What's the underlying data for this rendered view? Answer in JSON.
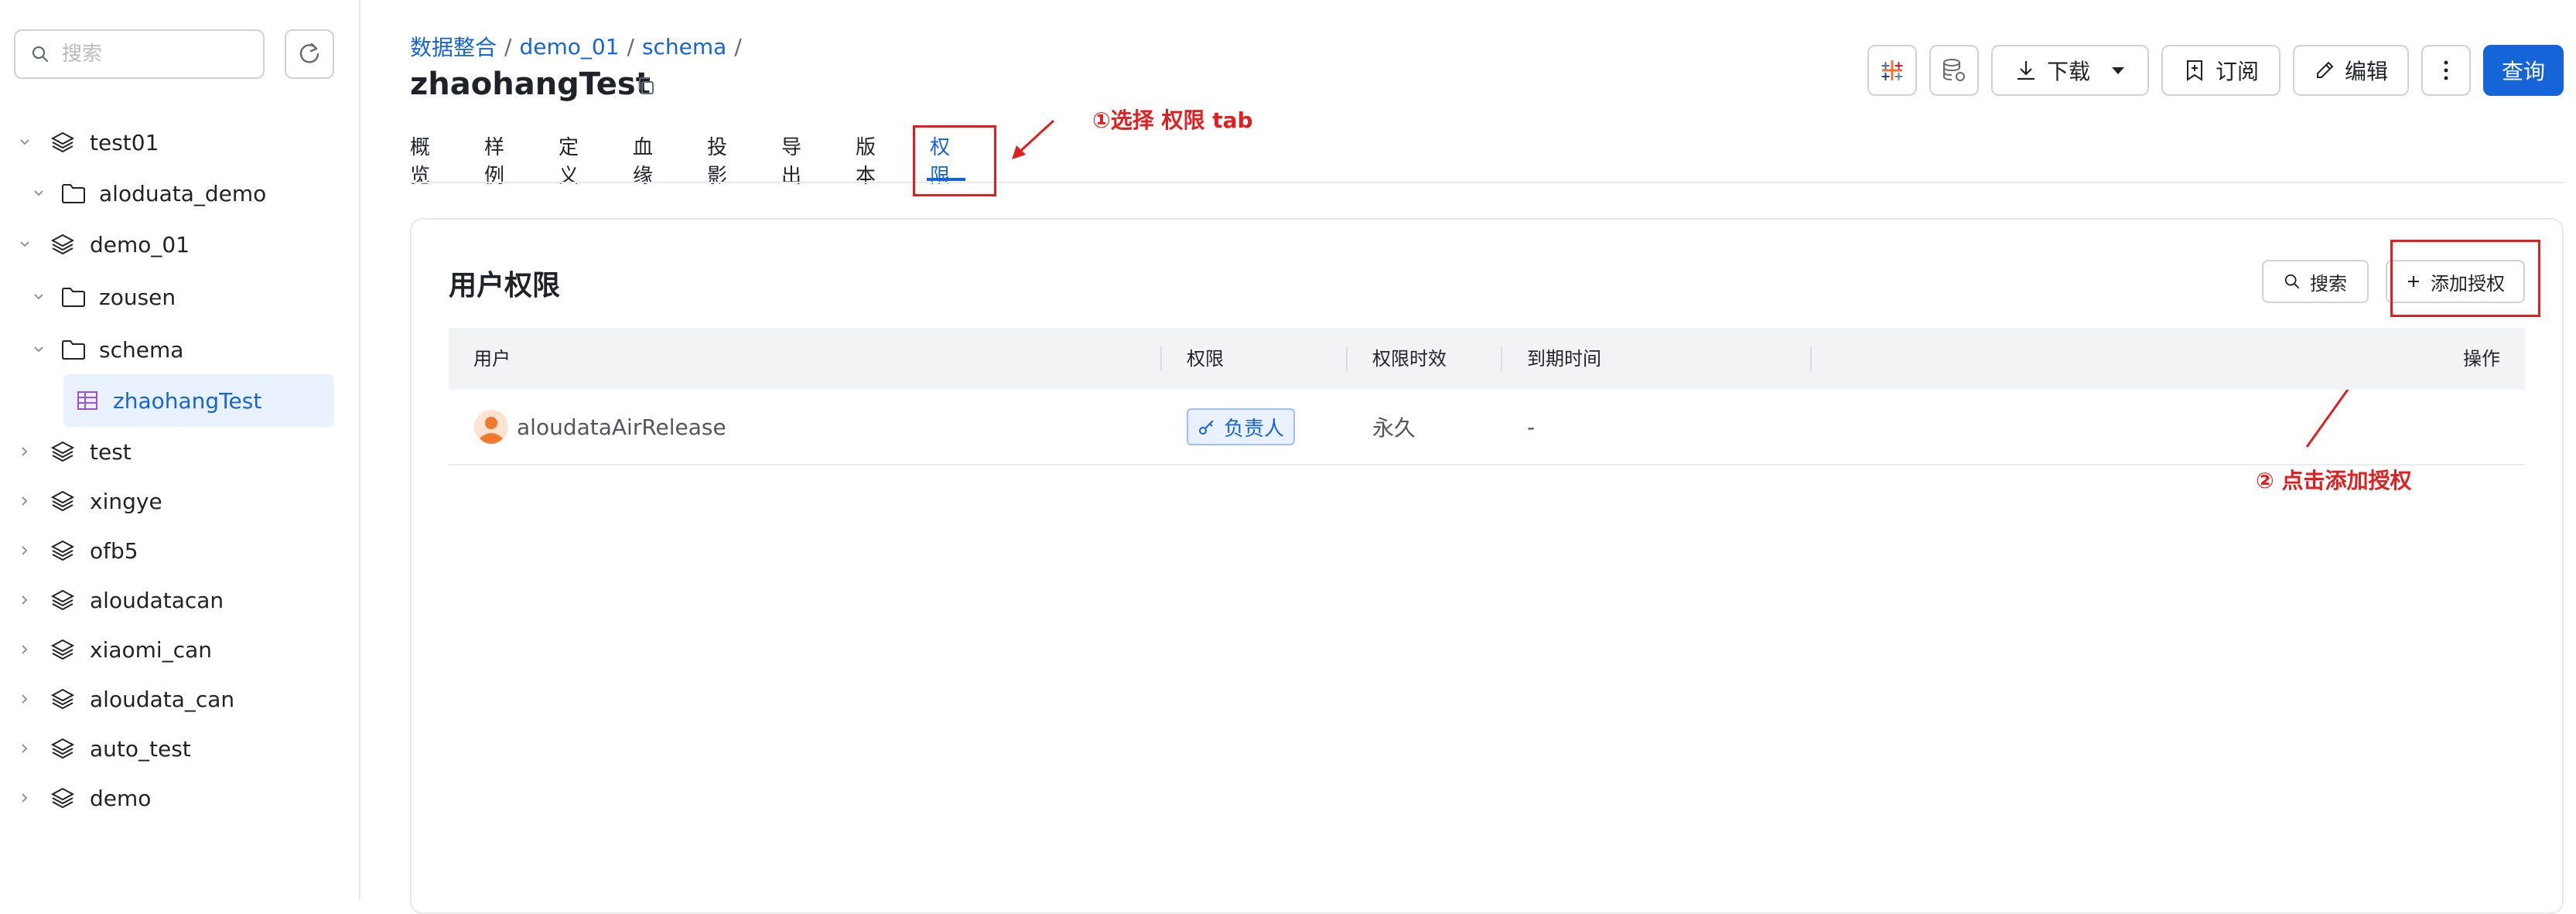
{
  "sidebar": {
    "search_placeholder": "搜索",
    "tree": [
      {
        "label": "test01"
      },
      {
        "label": "aloduata_demo"
      },
      {
        "label": "demo_01"
      },
      {
        "label": "zousen"
      },
      {
        "label": "schema"
      },
      {
        "label": "zhaohangTest"
      },
      {
        "label": "test"
      },
      {
        "label": "xingye"
      },
      {
        "label": "ofb5"
      },
      {
        "label": "aloudatacan"
      },
      {
        "label": "xiaomi_can"
      },
      {
        "label": "aloudata_can"
      },
      {
        "label": "auto_test"
      },
      {
        "label": "demo"
      }
    ]
  },
  "breadcrumb": {
    "items": [
      "数据整合",
      "demo_01",
      "schema"
    ],
    "separator": "/"
  },
  "page": {
    "title": "zhaohangTest"
  },
  "toolbar": {
    "download_label": "下载",
    "subscribe_label": "订阅",
    "edit_label": "编辑",
    "query_label": "查询"
  },
  "tabs": [
    {
      "label": "概览"
    },
    {
      "label": "样例"
    },
    {
      "label": "定义"
    },
    {
      "label": "血缘"
    },
    {
      "label": "投影"
    },
    {
      "label": "导出"
    },
    {
      "label": "版本"
    },
    {
      "label": "权限"
    }
  ],
  "annotations": {
    "step1": "①选择 权限 tab",
    "step2": "② 点击添加授权"
  },
  "permissions": {
    "title": "用户权限",
    "search_label": "搜索",
    "add_label": "添加授权",
    "columns": [
      "用户",
      "权限",
      "权限时效",
      "到期时间",
      "操作"
    ],
    "rows": [
      {
        "user": "aloudataAirRelease",
        "role": "负责人",
        "validity": "永久",
        "expiry": "-"
      }
    ]
  },
  "colors": {
    "accent": "#1565d8",
    "annotation": "#e02020"
  }
}
